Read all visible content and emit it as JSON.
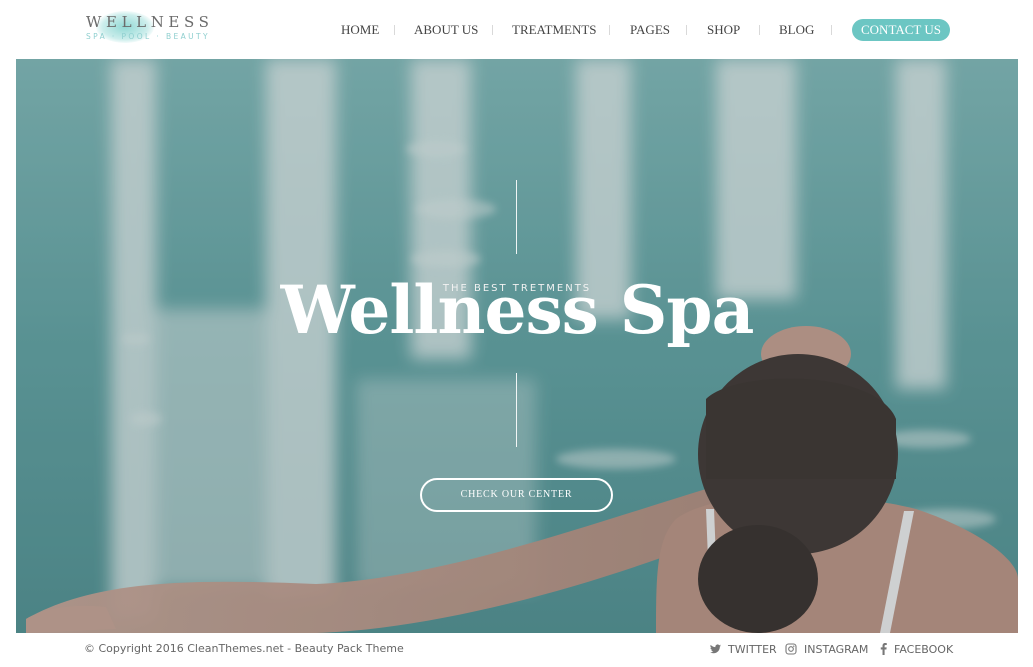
{
  "logo": {
    "title": "WELLNESS",
    "subtitle": "SPA · POOL · BEAUTY"
  },
  "nav": {
    "items": [
      "HOME",
      "ABOUT US",
      "TREATMENTS",
      "PAGES",
      "SHOP",
      "BLOG"
    ],
    "contact_label": "CONTACT US"
  },
  "hero": {
    "kicker": "THE BEST TRETMENTS",
    "title": "Wellness Spa",
    "button_label": "CHECK OUR CENTER"
  },
  "footer": {
    "copyright": "© Copyright 2016 CleanThemes.net - Beauty Pack Theme",
    "social": [
      {
        "label": "TWITTER",
        "icon": "twitter-icon"
      },
      {
        "label": "INSTAGRAM",
        "icon": "instagram-icon"
      },
      {
        "label": "FACEBOOK",
        "icon": "facebook-icon"
      }
    ]
  },
  "colors": {
    "accent": "#6cc6c3",
    "text": "#444444",
    "water": "#6fa7a7"
  }
}
